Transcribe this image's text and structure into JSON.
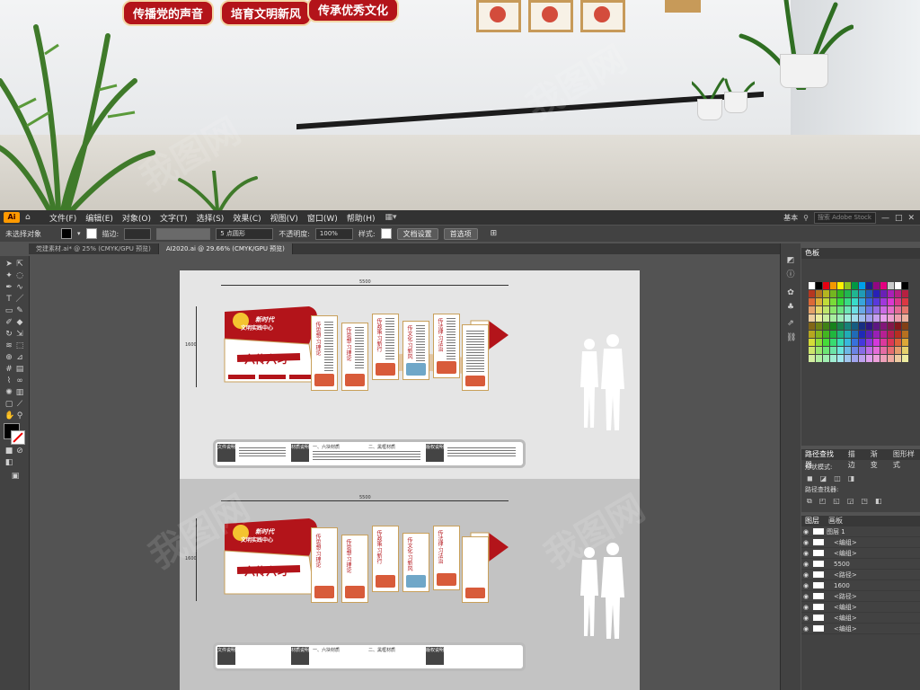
{
  "photo": {
    "banners": [
      "传播党的声音",
      "培育文明新风",
      "传承优秀文化"
    ]
  },
  "menubar": {
    "app_logo": "Ai",
    "items": [
      "文件(F)",
      "编辑(E)",
      "对象(O)",
      "文字(T)",
      "选择(S)",
      "效果(C)",
      "视图(V)",
      "窗口(W)",
      "帮助(H)"
    ],
    "workspace": "基本",
    "search_placeholder": "搜索 Adobe Stock"
  },
  "control_bar": {
    "selection": "未选择对象",
    "stroke_label": "描边:",
    "brush": "5 点圆形",
    "opacity_label": "不透明度:",
    "opacity_value": "100%",
    "style_label": "样式:",
    "doc_setup": "文档设置",
    "preferences": "首选项"
  },
  "tabs": [
    {
      "label": "党建素材.ai* @ 25% (CMYK/GPU 预览)",
      "active": false
    },
    {
      "label": "AI2020.ai @ 29.66% (CMYK/GPU 预览)",
      "active": true
    }
  ],
  "artwork": {
    "width_label": "5500",
    "height_label": "1600",
    "title_top": "新时代",
    "title_main": "文明实践中心",
    "slogan": "六传六习",
    "stand_texts": [
      "传思想·习理论",
      "传政策·习新行",
      "传文化·习新风",
      "传法律·习法治"
    ],
    "bottom_labels": [
      "文件说明",
      "材质说明",
      "版权说明"
    ],
    "bottom_items": [
      "一、六块材质",
      "二、黑框材质"
    ]
  },
  "panels": {
    "color_title": "色板",
    "pathfinder_tabs": [
      "路径查找器",
      "描边",
      "渐变",
      "图形样式"
    ],
    "shape_modes": "形状模式:",
    "pathfinders": "路径查找器:",
    "layers_tabs": [
      "图层",
      "画板"
    ],
    "layers": [
      {
        "name": "图层 1"
      },
      {
        "name": "<编组>"
      },
      {
        "name": "<编组>"
      },
      {
        "name": "5500"
      },
      {
        "name": "<路径>"
      },
      {
        "name": "1600"
      },
      {
        "name": "<路径>"
      },
      {
        "name": "<编组>"
      },
      {
        "name": "<编组>"
      },
      {
        "name": "<编组>"
      }
    ]
  },
  "watermark": "我图网"
}
